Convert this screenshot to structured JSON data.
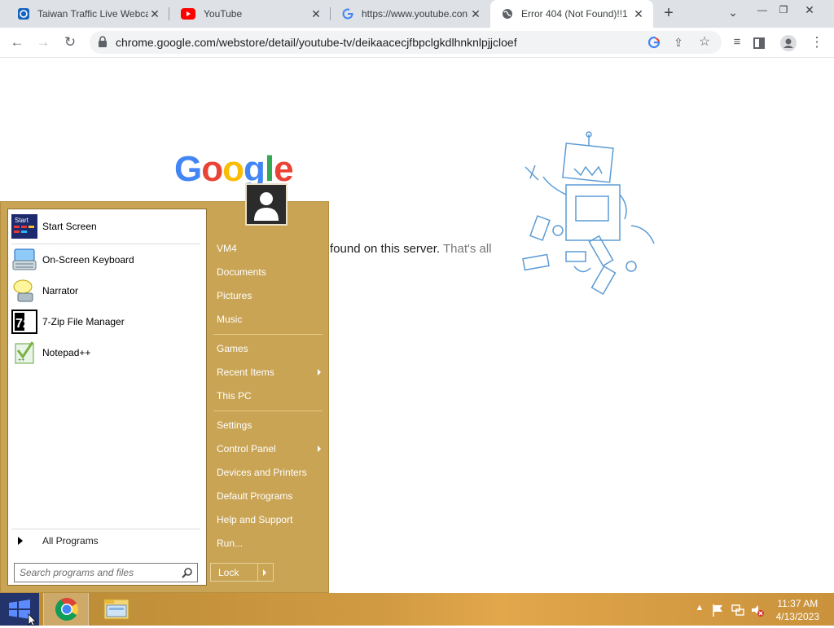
{
  "browser": {
    "tabs": [
      {
        "title": "Taiwan Traffic Live Webca",
        "active": false
      },
      {
        "title": "YouTube",
        "active": false
      },
      {
        "title": "https://www.youtube.con",
        "active": false
      },
      {
        "title": "Error 404 (Not Found)!!1",
        "active": true
      }
    ],
    "new_tab": "+",
    "address": "chrome.google.com/webstore/detail/youtube-tv/deikaacecjfbpclgkdlhnknlpjjcloef"
  },
  "page": {
    "logo": {
      "G": "G",
      "o1": "o",
      "o2": "o",
      "g": "g",
      "l": "l",
      "e": "e"
    },
    "message_visible": "found on this server.",
    "message_grey": "That's all"
  },
  "start_menu": {
    "programs": [
      {
        "label": "Start Screen",
        "icon": "start-screen-icon"
      },
      {
        "label": "On-Screen Keyboard",
        "icon": "keyboard-icon"
      },
      {
        "label": "Narrator",
        "icon": "narrator-icon"
      },
      {
        "label": "7-Zip File Manager",
        "icon": "7zip-icon"
      },
      {
        "label": "Notepad++",
        "icon": "notepad-plus-plus-icon"
      }
    ],
    "start_icon_text": "Start",
    "sevenzip_icon_text": "7z",
    "all_programs": "All Programs",
    "search_placeholder": "Search programs and files",
    "right_items": [
      {
        "label": "VM4"
      },
      {
        "label": "Documents"
      },
      {
        "label": "Pictures"
      },
      {
        "label": "Music"
      },
      {
        "label": "Games"
      },
      {
        "label": "Recent Items"
      },
      {
        "label": "This PC"
      },
      {
        "label": "Settings"
      },
      {
        "label": "Control Panel"
      },
      {
        "label": "Devices and Printers"
      },
      {
        "label": "Default Programs"
      },
      {
        "label": "Help and Support"
      },
      {
        "label": "Run..."
      }
    ],
    "lock_label": "Lock"
  },
  "taskbar": {
    "time": "11:37 AM",
    "date": "4/13/2023"
  },
  "colors": {
    "start_menu_bg": "#c9a454",
    "google_blue": "#4285f4",
    "google_red": "#ea4335",
    "google_yellow": "#fbbc05",
    "google_green": "#34a853"
  }
}
